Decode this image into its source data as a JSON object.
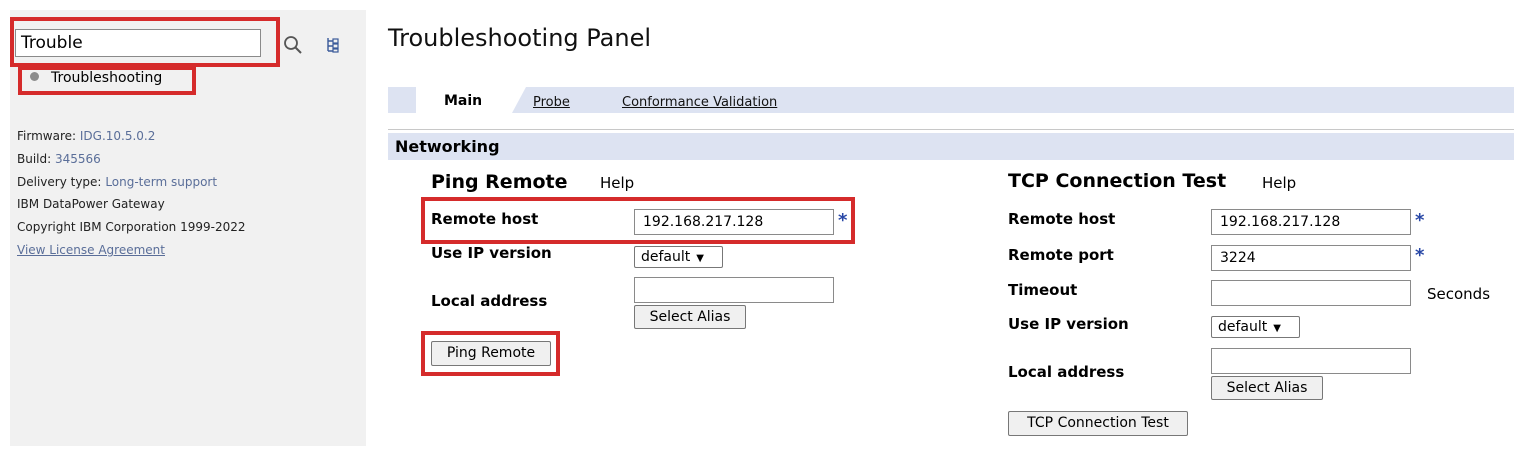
{
  "sidebar": {
    "search_value": "Trouble",
    "search_icon": "search-icon",
    "tree_icon": "tree-icon",
    "nav_item": "Troubleshooting",
    "info": {
      "firmware_label": "Firmware:",
      "firmware_value": "IDG.10.5.0.2",
      "build_label": "Build:",
      "build_value": "345566",
      "delivery_label": "Delivery type:",
      "delivery_value": "Long-term support",
      "product": "IBM DataPower Gateway",
      "copyright": "Copyright IBM Corporation 1999-2022",
      "license_link": "View License Agreement"
    }
  },
  "page": {
    "title": "Troubleshooting Panel",
    "tabs": [
      {
        "label": "Main",
        "active": true
      },
      {
        "label": "Probe",
        "active": false
      },
      {
        "label": "Conformance Validation",
        "active": false
      }
    ],
    "section": "Networking"
  },
  "ping": {
    "heading": "Ping Remote",
    "help": "Help",
    "remote_host_label": "Remote host",
    "remote_host_value": "192.168.217.128",
    "required": "*",
    "ip_version_label": "Use IP version",
    "ip_version_value": "default",
    "local_address_label": "Local address",
    "local_address_value": "",
    "select_alias": "Select Alias",
    "button": "Ping Remote"
  },
  "tcp": {
    "heading": "TCP Connection Test",
    "help": "Help",
    "remote_host_label": "Remote host",
    "remote_host_value": "192.168.217.128",
    "remote_port_label": "Remote port",
    "remote_port_value": "3224",
    "required": "*",
    "timeout_label": "Timeout",
    "timeout_value": "",
    "timeout_unit": "Seconds",
    "ip_version_label": "Use IP version",
    "ip_version_value": "default",
    "local_address_label": "Local address",
    "local_address_value": "",
    "select_alias": "Select Alias",
    "button": "TCP Connection Test"
  },
  "colors": {
    "highlight": "#d52b2b",
    "tab_bar": "#dde3f2",
    "link": "#5a6e99",
    "required_star": "#2847a6"
  }
}
